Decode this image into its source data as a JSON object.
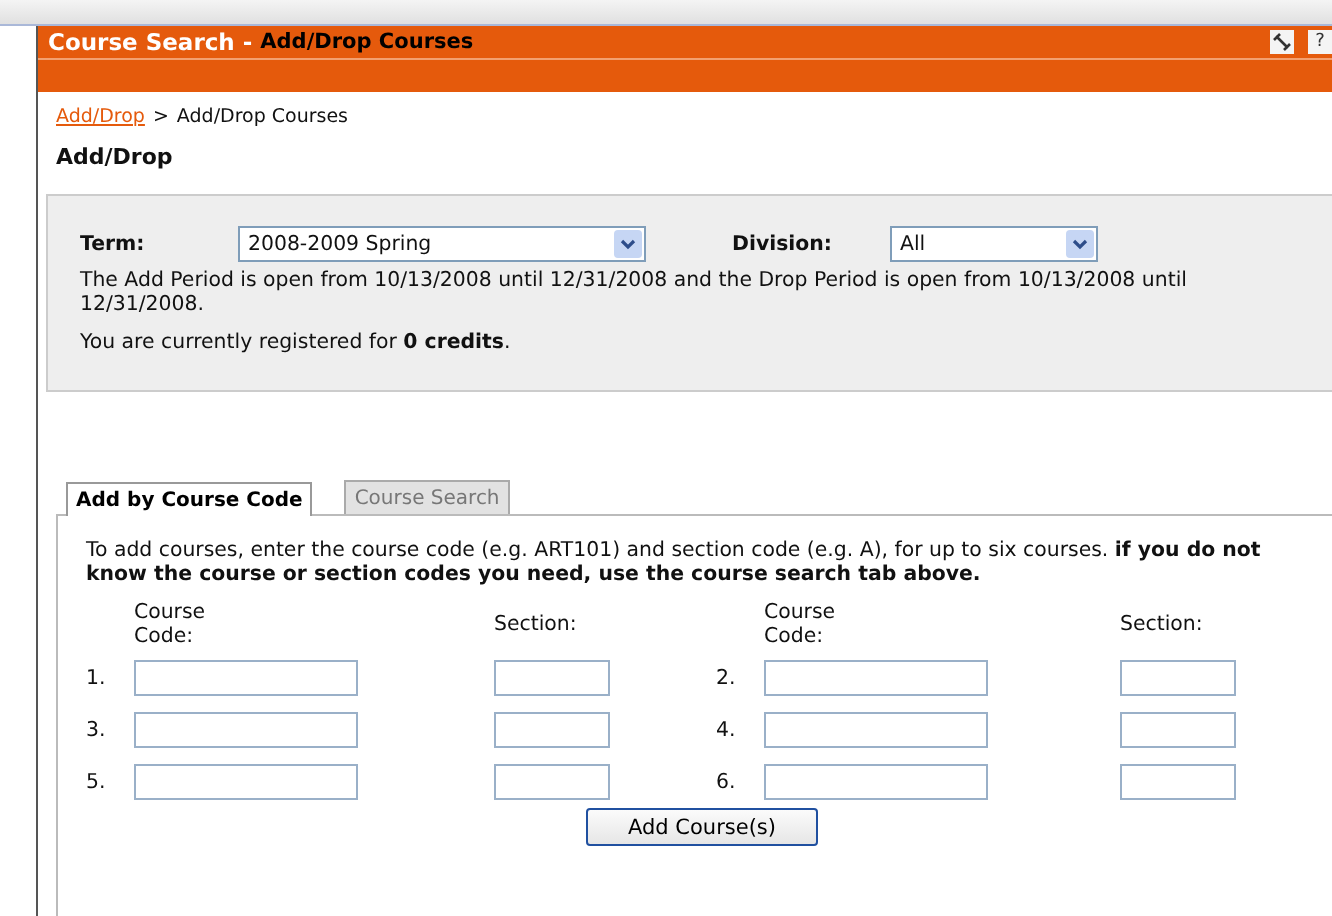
{
  "header": {
    "title": "Course Search",
    "separator": "-",
    "page": "Add/Drop Courses",
    "help_glyph": "?"
  },
  "breadcrumb": {
    "link": "Add/Drop",
    "separator": ">",
    "current": "Add/Drop Courses"
  },
  "heading": "Add/Drop",
  "filters": {
    "term_label": "Term:",
    "term_value": "2008-2009 Spring",
    "division_label": "Division:",
    "division_value": "All",
    "period_text": "The Add Period is open from 10/13/2008 until 12/31/2008 and the Drop Period is open from 10/13/2008 until 12/31/2008.",
    "credits_text": "You are currently registered for **0 credits**."
  },
  "tabs": [
    {
      "label": "Add by Course Code",
      "selected": true
    },
    {
      "label": "Course Search",
      "selected": false
    }
  ],
  "instructions": "To add courses, enter the course code (e.g. ART101) and section code (e.g. A), for up to six courses. **if you do not know the course or section codes you need, use the course search tab above.**",
  "column_headers": [
    "Course Code:",
    "Section:",
    "Course Code:",
    "Section:"
  ],
  "entries": [
    {
      "number": "1."
    },
    {
      "number": "2."
    },
    {
      "number": "3."
    },
    {
      "number": "4."
    },
    {
      "number": "5."
    },
    {
      "number": "6."
    }
  ],
  "submit_button": "Add Course(s)"
}
